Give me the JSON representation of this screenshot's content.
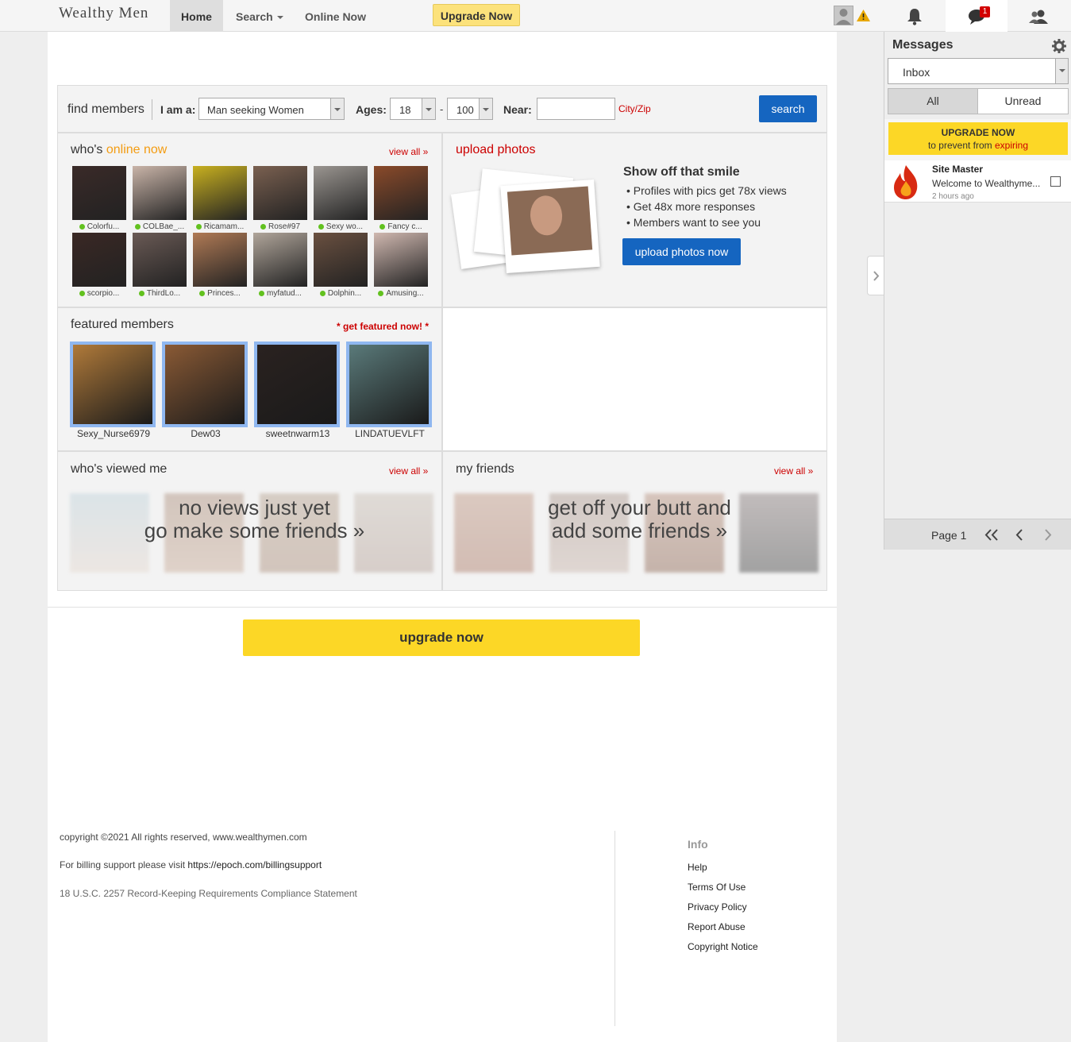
{
  "brand": {
    "logo": "Wealthy Men"
  },
  "nav": {
    "home": "Home",
    "search": "Search",
    "online_now": "Online Now",
    "upgrade": "Upgrade Now"
  },
  "topbar": {
    "messages_badge": "1"
  },
  "search": {
    "label": "find members",
    "iam_label": "I am a:",
    "iam_value": "Man seeking Women",
    "ages_label": "Ages:",
    "age_min": "18",
    "age_sep": "-",
    "age_max": "100",
    "near_label": "Near:",
    "near_placeholder": "",
    "cityzip": "City/Zip",
    "button": "search"
  },
  "online": {
    "title_prefix": "who's ",
    "title_highlight": "online now",
    "view_all": "view all »",
    "members": [
      {
        "name": "Colorfu...",
        "color": "#3a2a28"
      },
      {
        "name": "COLBae_...",
        "color": "#c9b4a8"
      },
      {
        "name": "Ricamam...",
        "color": "#c8b020"
      },
      {
        "name": "Rose#97",
        "color": "#7a6050"
      },
      {
        "name": "Sexy wo...",
        "color": "#9a9590"
      },
      {
        "name": "Fancy c...",
        "color": "#8a4a2a"
      },
      {
        "name": "scorpio...",
        "color": "#3a2824"
      },
      {
        "name": "ThirdLo...",
        "color": "#6a5a55"
      },
      {
        "name": "Princes...",
        "color": "#b07a55"
      },
      {
        "name": "myfatud...",
        "color": "#b0a59a"
      },
      {
        "name": "Dolphin...",
        "color": "#6a5040"
      },
      {
        "name": "Amusing...",
        "color": "#d0b8b0"
      }
    ]
  },
  "upload": {
    "title": "upload photos",
    "heading": "Show off that smile",
    "bullets": [
      "Profiles with pics get 78x views",
      "Get 48x more responses",
      "Members want to see you"
    ],
    "button": "upload photos now"
  },
  "featured": {
    "title": "featured members",
    "cta": "* get featured now! *",
    "members": [
      {
        "name": "Sexy_Nurse6979",
        "color": "#b07a3a"
      },
      {
        "name": "Dew03",
        "color": "#8a5a35"
      },
      {
        "name": "sweetnwarm13",
        "color": "#2a2220"
      },
      {
        "name": "LINDATUEVLFT",
        "color": "#5a7a7a"
      }
    ]
  },
  "viewed": {
    "title": "who's viewed me",
    "view_all": "view all »",
    "line1": "no views just yet",
    "line2": "go make some friends »"
  },
  "friends": {
    "title": "my friends",
    "view_all": "view all »",
    "line1": "get off your butt and",
    "line2": "add some friends »"
  },
  "upgrade_bar": {
    "label": "upgrade now"
  },
  "footer": {
    "copyright": "copyright ©2021 All rights reserved, www.wealthymen.com",
    "billing_prefix": "For billing support please visit ",
    "billing_link": "https://epoch.com/billingsupport",
    "compliance": "18 U.S.C. 2257 Record-Keeping Requirements Compliance Statement",
    "info_title": "Info",
    "links": [
      "Help",
      "Terms Of Use",
      "Privacy Policy",
      "Report Abuse",
      "Copyright Notice"
    ]
  },
  "messages": {
    "title": "Messages",
    "folder": "Inbox",
    "tab_all": "All",
    "tab_unread": "Unread",
    "upgrade_line1": "UPGRADE NOW",
    "upgrade_line2_prefix": "to prevent from ",
    "upgrade_line2_highlight": "expiring",
    "items": [
      {
        "sender": "Site Master",
        "preview": "Welcome to Wealthyme...",
        "time": "2 hours ago"
      }
    ],
    "page_label": "Page 1"
  },
  "colors": {
    "accent_red": "#cc0000",
    "online_orange": "#f39c12",
    "primary_blue": "#1565c0",
    "upgrade_yellow": "#fcd726"
  }
}
